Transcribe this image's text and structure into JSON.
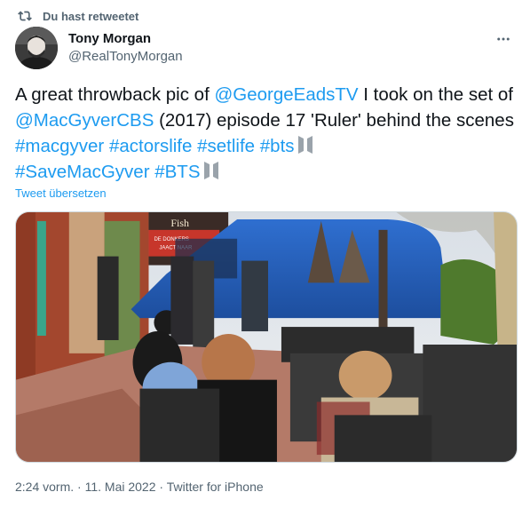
{
  "retweet_banner": {
    "icon": "retweet-icon",
    "text": "Du hast retweetet"
  },
  "author": {
    "name": "Tony Morgan",
    "handle": "@RealTonyMorgan",
    "avatar_icon": "avatar-photo"
  },
  "more_icon": "more-options-icon",
  "tweet": {
    "segments": [
      {
        "type": "text",
        "value": "A great throwback pic of "
      },
      {
        "type": "link",
        "value": "@GeorgeEadsTV"
      },
      {
        "type": "text",
        "value": " I took on the set of "
      },
      {
        "type": "link",
        "value": "@MacGyverCBS"
      },
      {
        "type": "text",
        "value": " (2017) episode 17 'Ruler' behind the scenes "
      },
      {
        "type": "link",
        "value": "#macgyver"
      },
      {
        "type": "text",
        "value": " "
      },
      {
        "type": "link",
        "value": "#actorslife"
      },
      {
        "type": "text",
        "value": " "
      },
      {
        "type": "link",
        "value": "#setlife"
      },
      {
        "type": "text",
        "value": " "
      },
      {
        "type": "link",
        "value": "#bts"
      },
      {
        "type": "emoji",
        "value": "bts-emoji"
      },
      {
        "type": "break"
      },
      {
        "type": "link",
        "value": "#SaveMacGyver"
      },
      {
        "type": "text",
        "value": " "
      },
      {
        "type": "link",
        "value": "#BTS"
      },
      {
        "type": "emoji",
        "value": "bts-emoji"
      }
    ]
  },
  "translate_label": "Tweet übersetzen",
  "media": {
    "kind": "photo",
    "description_icon": "tweet-photo",
    "signs": {
      "sign1": "Fish",
      "sign2": "DE DONKERS",
      "sign3": "JAACT NAAR"
    }
  },
  "meta": {
    "time": "2:24 vorm.",
    "separator1": " · ",
    "date": "11. Mai 2022",
    "separator2": " · ",
    "source": "Twitter for iPhone"
  },
  "colors": {
    "link": "#1d9bf0",
    "text": "#0f1419",
    "secondary": "#536471"
  }
}
